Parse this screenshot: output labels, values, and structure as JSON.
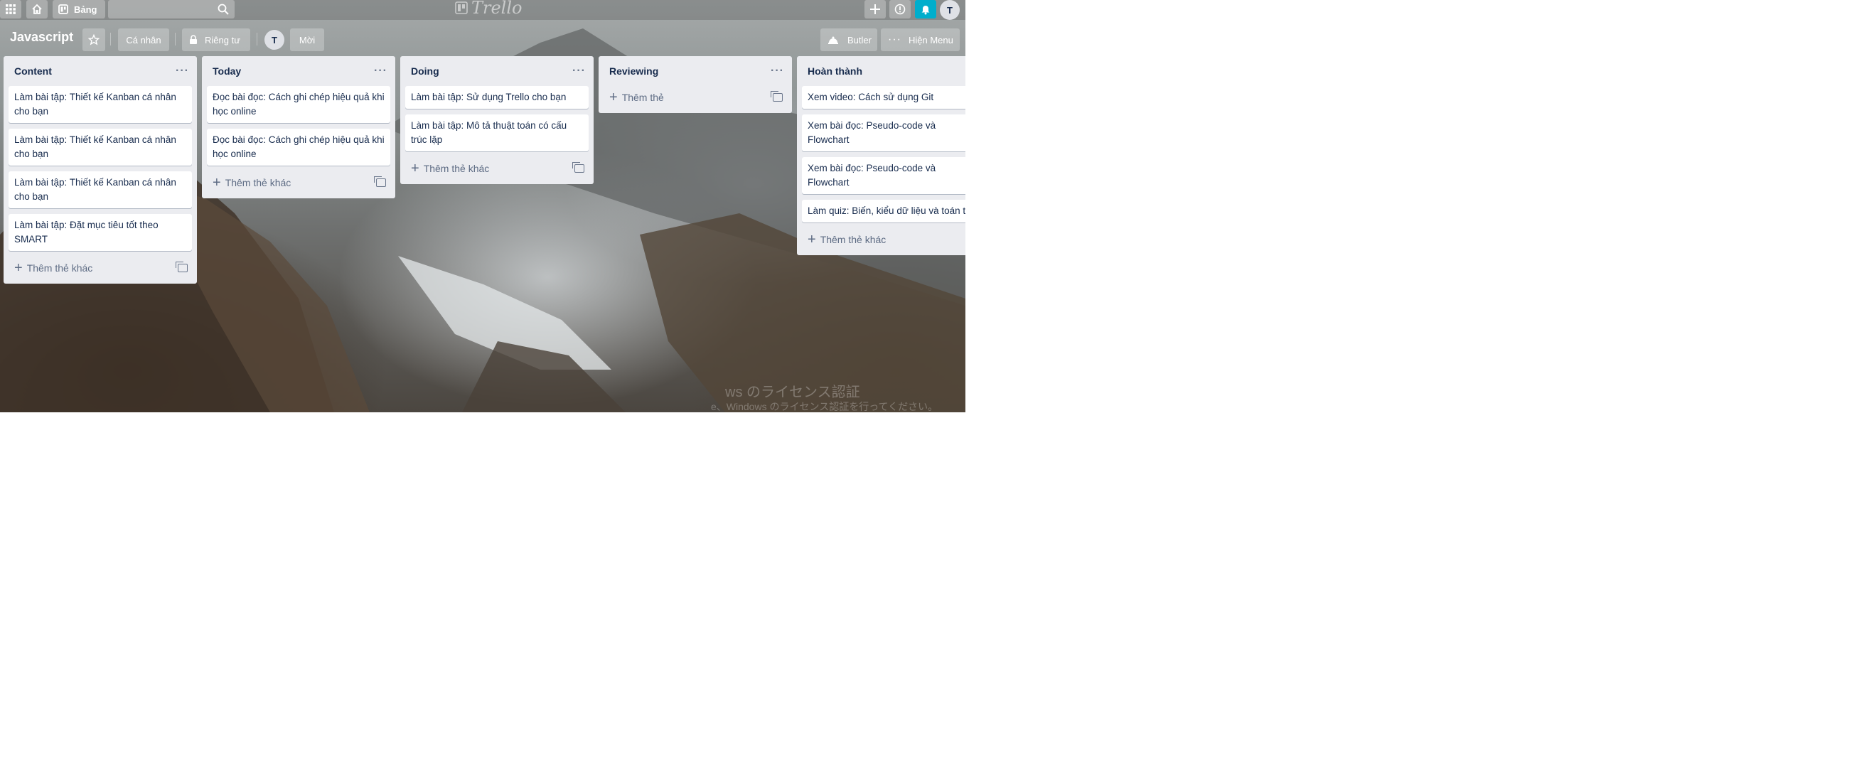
{
  "topbar": {
    "boards_label": "Bảng",
    "search_value": "",
    "logo_text": "Trello",
    "avatar_initial": "T"
  },
  "board": {
    "title": "Javascript",
    "team_label": "Cá nhân",
    "visibility_label": "Riêng tư",
    "member_initial": "T",
    "invite_label": "Mời",
    "butler_label": "Butler",
    "menu_label": "Hiện Menu"
  },
  "lists": [
    {
      "title": "Content",
      "cards": [
        "Làm bài tập: Thiết kế Kanban cá nhân cho bạn",
        "Làm bài tập: Thiết kế Kanban cá nhân cho bạn",
        "Làm bài tập: Thiết kế Kanban cá nhân cho bạn",
        "Làm bài tập: Đặt mục tiêu tốt theo SMART"
      ],
      "add_label": "Thêm thẻ khác"
    },
    {
      "title": "Today",
      "cards": [
        "Đọc bài đọc: Cách ghi chép hiệu quả khi học online",
        "Đọc bài đọc: Cách ghi chép hiệu quả khi học online"
      ],
      "add_label": "Thêm thẻ khác"
    },
    {
      "title": "Doing",
      "cards": [
        "Làm bài tập: Sử dụng Trello cho bạn",
        "Làm bài tập: Mô tả thuật toán có cấu trúc lặp"
      ],
      "add_label": "Thêm thẻ khác"
    },
    {
      "title": "Reviewing",
      "cards": [],
      "add_label": "Thêm thẻ"
    },
    {
      "title": "Hoàn thành",
      "cards": [
        "Xem video: Cách sử dụng Git",
        "Xem bài đọc: Pseudo-code và Flowchart",
        "Xem bài đọc: Pseudo-code và Flowchart",
        "Làm quiz: Biến, kiểu dữ liệu và toán tử"
      ],
      "add_label": "Thêm thẻ khác"
    }
  ],
  "watermark": {
    "line1": "ws のライセンス認証",
    "line2": "e、Windows のライセンス認証を行ってください。"
  },
  "colors": {
    "notification_button": "#00aecc",
    "list_background": "#ebecf0",
    "card_background": "#ffffff",
    "text_dark": "#172b4d"
  }
}
